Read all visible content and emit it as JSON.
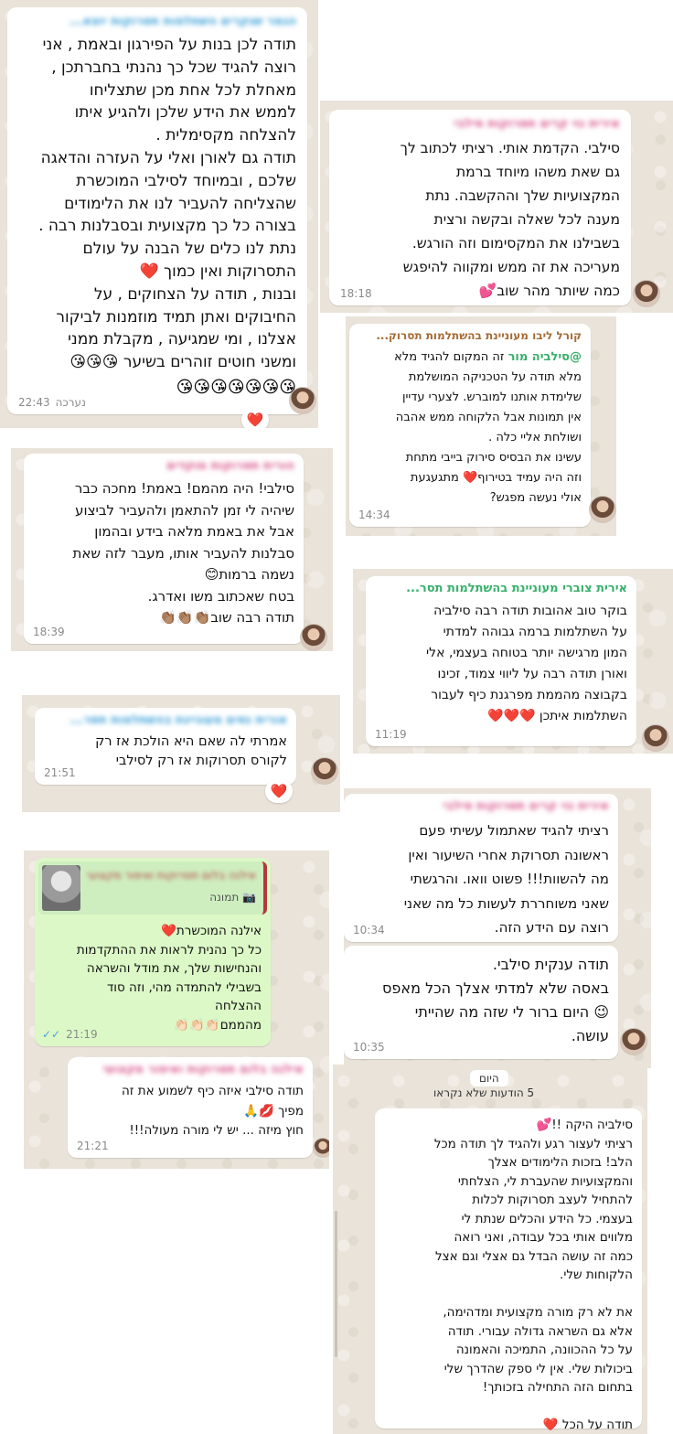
{
  "messages": {
    "m1": {
      "sender": "הגמר שנקרים השתלמות תסרוקות יוצא...",
      "text": "תודה לכן בנות על הפירגון ובאמת , אני\nרוצה להגיד שכל כך נהנתי בחברתכן ,\nמאחלת לכל אחת מכן שתצליחו\nלממש את הידע שלכן ולהגיע איתו\nלהצלחה מקסימלית .\nתודה גם לאורן ואלי על העזרה והדאגה\nשלכם , ובמיוחד לסילבי המוכשרת\nשהצליחה להעביר לנו את הלימודים\nבצורה כל כך מקצועית ובסבלנות רבה .\nנתת לנו כלים של הבנה על עולם\nהתסרוקות ואין כמוך ❤️\nובנות , תודה על הצחוקים , על\nהחיבוקים ואתן תמיד מוזמנות לביקור\nאצלנו , ומי שמגיעה , מקבלת ממני\nומשני חוטים זוהרים בשיער 😘😘😘",
      "emojis": "😘😘😘😘😘😘😘",
      "time": "22:43",
      "edited": "נערכה",
      "reaction": "❤️"
    },
    "m2": {
      "sender": "אירית נוי קרים תסרוקות סילבי",
      "text": "סילבי. הקדמת אותי. רציתי לכתוב לך\nגם שאת משהו מיוחד ברמת\nהמקצועיות שלך וההקשבה. נתת\nמענה לכל שאלה ובקשה ורצית\nבשבילנו את המקסימום וזה הורגש.\nמעריכה את זה ממש ומקווה להיפגש\nכמה שיותר מהר שוב💕",
      "time": "18:18"
    },
    "m3": {
      "sender": "קורל ליבו מעוניינת בהשתלמות תסרוק...",
      "mention": "@סילביה מור",
      "text": " זה המקום להגיד מלא\nמלא תודה על הטכניקה המושלמת\nשלימדת אותנו למוברש. לצערי עדיין\nאין תמונות אבל הלקוחה ממש אהבה\nושולחת אליי כלה .\nעשינו את הבסיס סירוק בייבי מתחת\nוזה היה עמיד בטירוף❤️ מתגעגעת\nאולי נעשה מפגש?",
      "time": "14:34"
    },
    "m4": {
      "sender": "הורית תסרוקות מוקדים",
      "text": "סילבי! היה מהמם! באמת! מחכה כבר\nשיהיה לי זמן להתאמן ולהעביר לביצוע\nאבל את באמת מלאה בידע ובהמון\nסבלנות להעביר אותו, מעבר לזה שאת\nנשמה ברמות😊\nבטח שאכתוב משו ואדרג.\nתודה רבה שוב👏🏽👏🏽👏🏽",
      "time": "18:39"
    },
    "m5": {
      "sender": "אירית צוברי מעוניינת בהשתלמות תסר...",
      "text": "בוקר טוב אהובות תודה רבה סילביה\nעל השתלמות ברמה גבוהה למדתי\nהמון מרגישה יותר בטוחה בעצמי, אלי\nואורן תודה רבה על ליווי צמוד, זכינו\nבקבוצה מהממת מפרגנת   כיף לעבור\nהשתלמות איתכן ❤️❤️❤️",
      "time": "11:19"
    },
    "m6": {
      "sender": "אורית נסים מעוניינת בהשתלמות תסר...",
      "text": "אמרתי לה שאם היא הולכת אז רק\nלקורס תסרוקות אז רק לסילבי",
      "time": "21:51",
      "reaction": "❤️"
    },
    "m7": {
      "sender": "אירית נוי קרים תסרוקות סילבי",
      "text": "רציתי להגיד שאתמול עשיתי פעם\nראשונה תסרוקת אחרי השיעור ואין\nמה להשוות!!! פשוט וואו. והרגשתי\nשאני משוחררת לעשות כל מה שאני\nרוצה עם הידע הזה.",
      "time": "10:34"
    },
    "m8": {
      "text": "תודה ענקית סילבי.\nבאסה שלא למדתי אצלך הכל מאפס\n😉 היום ברור לי שזה מה שהייתי\nעושה.",
      "time": "10:35"
    },
    "m9": {
      "quote_sender": "אילנה בלום תסרוקות ואיפור מקצועי",
      "quote_label": "📷 תמונה",
      "text": "אילנה המוכשרת❤️\nכל כך נהנית לראות את ההתקדמות\nוהנחישות שלך, את מודל והשראה\nבשבילי להתמדה מהי, וזה סוד\nההצלחה\nמהממם👏🏻👏🏻👏🏻",
      "time": "21:19"
    },
    "m10": {
      "sender": "אילנה בלום תסרוקות ואיפור מקצועי",
      "text": "תודה סילבי איזה כיף לשמוע את זה\nמפיך 💋🙏\nחוץ מיזה ... יש לי מורה מעולה!!!",
      "time": "21:21"
    },
    "m11": {
      "text": "סילביה היקה !!💕\nרציתי לעצור רגע ולהגיד לך תודה מכל\nהלב! בזכות הלימודים אצלך\nוהמקצועיות שהעברת לי, הצלחתי\nלהתחיל לעצב תסרוקות לכלות\nבעצמי. כל הידע והכלים שנתת לי\nמלווים אותי בכל עבודה, ואני רואה\nכמה זה עושה הבדל גם אצלי וגם אצל\nהלקוחות שלי.\n\nאת לא רק מורה מקצועית ומדהימה,\nאלא גם השראה גדולה עבורי. תודה\nעל כל ההכוונה, התמיכה והאמונה\nביכולות שלי. אין לי ספק שהדרך שלי\nבתחום הזה התחילה בזכותך!\n\nתודה על הכל ❤️"
    }
  },
  "divider": {
    "date_label": "היום",
    "unread_label": "5 הודעות שלא נקראו"
  }
}
